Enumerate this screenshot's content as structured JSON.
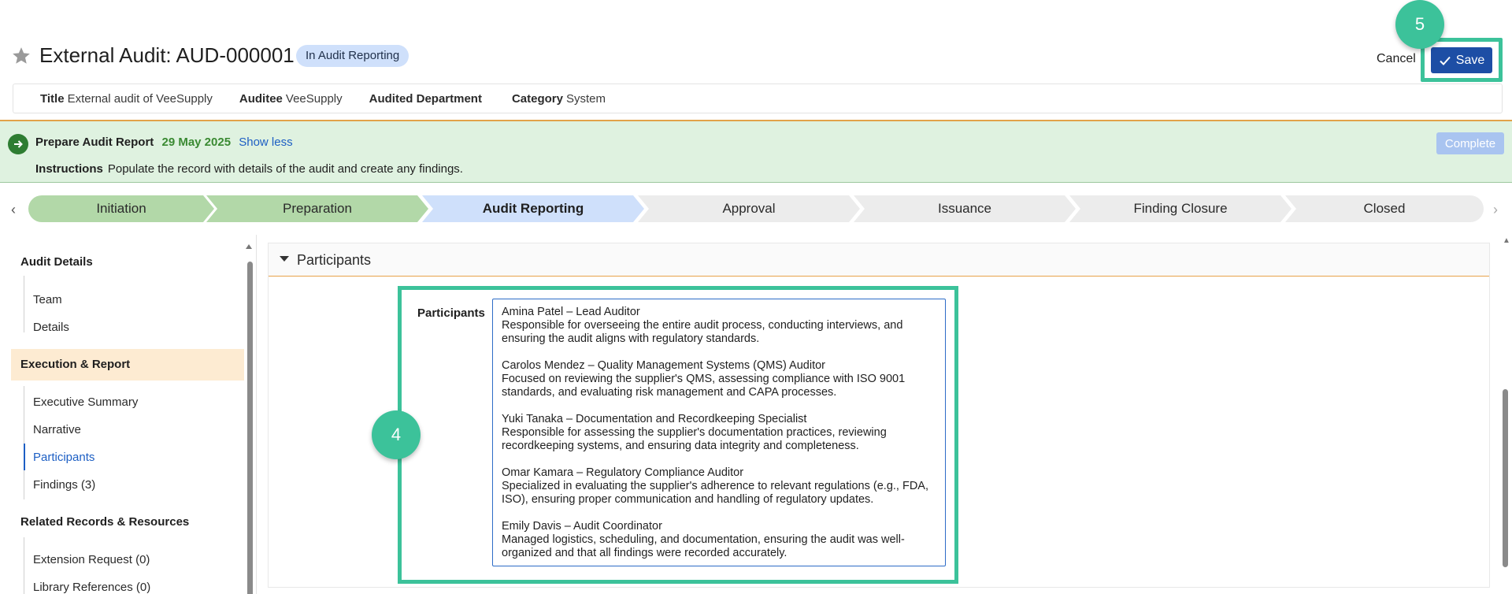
{
  "header": {
    "record_title": "External Audit: AUD-000001",
    "status": "In Audit Reporting",
    "cancel_label": "Cancel",
    "save_label": "Save"
  },
  "markers": {
    "step_save": "5",
    "step_participants": "4"
  },
  "meta": [
    {
      "label": "Title",
      "value": "External audit of VeeSupply"
    },
    {
      "label": "Auditee",
      "value": "VeeSupply"
    },
    {
      "label": "Audited Department",
      "value": ""
    },
    {
      "label": "Category",
      "value": "System"
    }
  ],
  "task": {
    "name": "Prepare Audit Report",
    "due_date": "29 May 2025",
    "toggle_label": "Show less",
    "instructions_label": "Instructions",
    "instructions_text": "Populate the record with details of the audit and create any findings.",
    "complete_label": "Complete"
  },
  "stages": [
    {
      "label": "Initiation",
      "state": "done"
    },
    {
      "label": "Preparation",
      "state": "done"
    },
    {
      "label": "Audit Reporting",
      "state": "current"
    },
    {
      "label": "Approval",
      "state": "todo"
    },
    {
      "label": "Issuance",
      "state": "todo"
    },
    {
      "label": "Finding Closure",
      "state": "todo"
    },
    {
      "label": "Closed",
      "state": "todo"
    }
  ],
  "sidebar": {
    "sections": [
      {
        "title": "Audit Details",
        "items": [
          "Team",
          "Details"
        ]
      },
      {
        "title": "Execution & Report",
        "items": [
          "Executive Summary",
          "Narrative",
          "Participants",
          "Findings (3)"
        ]
      },
      {
        "title": "Related Records & Resources",
        "items": [
          "Extension Request (0)",
          "Library References (0)"
        ]
      }
    ],
    "selected_item": "Participants"
  },
  "main": {
    "section_title": "Participants",
    "field_label": "Participants",
    "participants": [
      {
        "name": "Amina Patel – Lead Auditor",
        "desc": "Responsible for overseeing the entire audit process, conducting interviews, and ensuring the audit aligns with regulatory standards."
      },
      {
        "name": "Carolos Mendez – Quality Management Systems (QMS) Auditor",
        "desc": "Focused on reviewing the supplier's QMS, assessing compliance with ISO 9001 standards, and evaluating risk management and CAPA processes."
      },
      {
        "name": "Yuki Tanaka – Documentation and Recordkeeping Specialist",
        "desc": "Responsible for assessing the supplier's documentation practices, reviewing recordkeeping systems, and ensuring data integrity and completeness."
      },
      {
        "name": "Omar Kamara – Regulatory Compliance Auditor",
        "desc": "Specialized in evaluating the supplier's adherence to relevant regulations (e.g., FDA, ISO), ensuring proper communication and handling of regulatory updates."
      },
      {
        "name": "Emily Davis – Audit Coordinator",
        "desc": "Managed logistics, scheduling, and documentation, ensuring the audit was well-organized and that all findings were recorded accurately."
      }
    ]
  },
  "colors": {
    "accent": "#1d4ea5",
    "highlight": "#3cc29a",
    "stage_done": "#b2d8a8",
    "stage_current": "#cfe0fb",
    "banner": "#dff2e0"
  }
}
